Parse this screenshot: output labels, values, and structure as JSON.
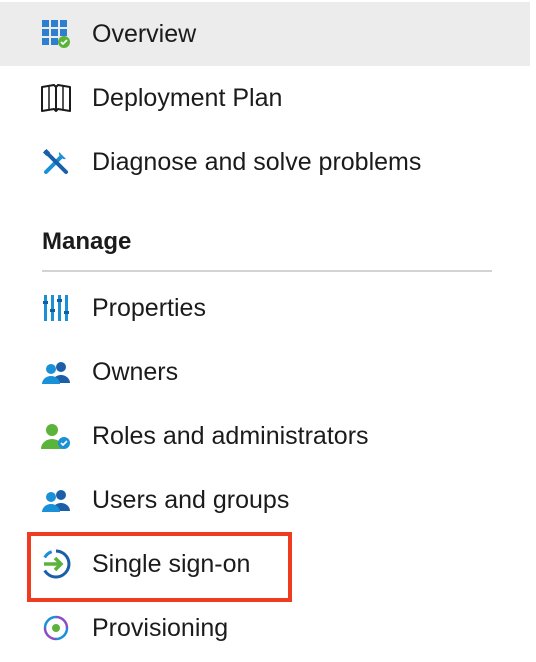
{
  "nav": {
    "top_items": [
      {
        "label": "Overview",
        "icon": "overview-grid-icon",
        "selected": true
      },
      {
        "label": "Deployment Plan",
        "icon": "book-icon",
        "selected": false
      },
      {
        "label": "Diagnose and solve problems",
        "icon": "wrench-screwdriver-icon",
        "selected": false
      }
    ],
    "manage": {
      "header": "Manage",
      "items": [
        {
          "label": "Properties",
          "icon": "properties-bars-icon"
        },
        {
          "label": "Owners",
          "icon": "owners-people-icon"
        },
        {
          "label": "Roles and administrators",
          "icon": "roles-person-icon"
        },
        {
          "label": "Users and groups",
          "icon": "users-groups-icon"
        },
        {
          "label": "Single sign-on",
          "icon": "single-sign-on-icon",
          "highlighted": true
        },
        {
          "label": "Provisioning",
          "icon": "provisioning-icon"
        }
      ]
    }
  },
  "colors": {
    "selected_bg": "#ececec",
    "highlight_border": "#ef3b1f",
    "icon_blue": "#1a90d6",
    "icon_green": "#5ab33a",
    "text": "#1b1b1b"
  }
}
